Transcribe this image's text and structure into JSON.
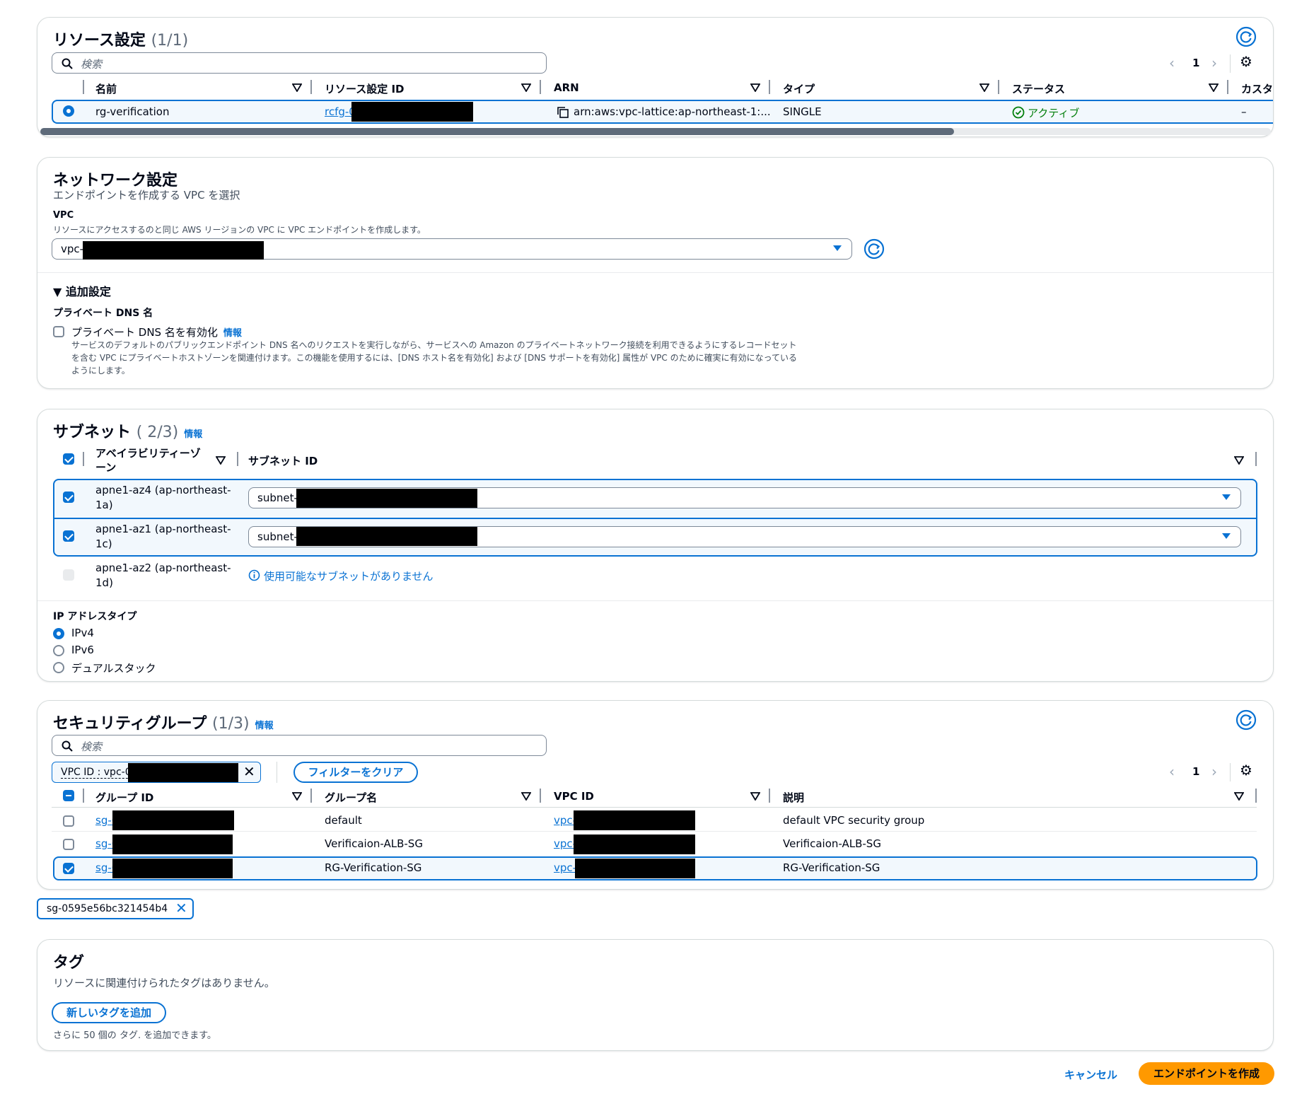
{
  "resource_config": {
    "title": "リソース設定",
    "count": "(1/1)",
    "search_placeholder": "検索",
    "page": "1",
    "columns": [
      "名前",
      "リソース設定 ID",
      "ARN",
      "タイプ",
      "ステータス",
      "カスタ"
    ],
    "row": {
      "name": "rg-verification",
      "id_prefix": "rcfg-0",
      "arn": "arn:aws:vpc-lattice:ap-northeast-1:...",
      "type": "SINGLE",
      "status": "アクティブ",
      "custom": "–"
    }
  },
  "network": {
    "title": "ネットワーク設定",
    "subtitle": "エンドポイントを作成する VPC を選択",
    "vpc_label": "VPC",
    "vpc_desc": "リソースにアクセスするのと同じ AWS リージョンの VPC に VPC エンドポイントを作成します。",
    "vpc_value_prefix": "vpc-",
    "additional": "追加設定",
    "private_dns_heading": "プライベート DNS 名",
    "private_dns_checkbox": "プライベート DNS 名を有効化",
    "info": "情報",
    "private_dns_desc1": "サービスのデフォルトのパブリックエンドポイント DNS 名へのリクエストを実行しながら、サービスへの Amazon のプライベートネットワーク接続を利用できるようにするレコードセット",
    "private_dns_desc2": "を含む VPC にプライベートホストゾーンを関連付けます。この機能を使用するには、[DNS ホスト名を有効化] および [DNS サポートを有効化] 属性が VPC のために確実に有効になっている",
    "private_dns_desc3": "ようにします。"
  },
  "subnets": {
    "title": "サブネット",
    "count": "( 2/3)",
    "info": "情報",
    "col_az_1": "アベイラビリティーゾ",
    "col_az_2": "ーン",
    "col_subnet": "サブネット ID",
    "rows": [
      {
        "az1": "apne1-az4 (ap-northeast-",
        "az2": "1a)",
        "subnet_prefix": "subnet-"
      },
      {
        "az1": "apne1-az1 (ap-northeast-",
        "az2": "1c)",
        "subnet_prefix": "subnet-"
      },
      {
        "az1": "apne1-az2 (ap-northeast-",
        "az2": "1d)",
        "none": "使用可能なサブネットがありません"
      }
    ],
    "ip_type_label": "IP アドレスタイプ",
    "ip_options": [
      "IPv4",
      "IPv6",
      "デュアルスタック"
    ]
  },
  "security_groups": {
    "title": "セキュリティグループ",
    "count": "(1/3)",
    "info": "情報",
    "search_placeholder": "検索",
    "filter_token": "VPC ID : vpc-0",
    "clear_filter": "フィルターをクリア",
    "page": "1",
    "columns": [
      "グループ ID",
      "グループ名",
      "VPC ID",
      "説明"
    ],
    "rows": [
      {
        "id_prefix": "sg-0",
        "name": "default",
        "vpc_prefix": "vpc-",
        "desc": "default VPC security group"
      },
      {
        "id_prefix": "sg-0",
        "name": "Verificaion-ALB-SG",
        "vpc_prefix": "vpc-",
        "desc": "Verificaion-ALB-SG"
      },
      {
        "id_prefix": "sg-0",
        "name": "RG-Verification-SG",
        "vpc_prefix": "vpc-",
        "desc": "RG-Verification-SG"
      }
    ],
    "selected_token": "sg-0595e56bc321454b4"
  },
  "tags": {
    "title": "タグ",
    "empty": "リソースに関連付けられたタグはありません。",
    "add_button": "新しいタグを追加",
    "hint": "さらに 50 個の タグ. を追加できます。"
  },
  "footer": {
    "cancel": "キャンセル",
    "create": "エンドポイントを作成"
  },
  "colors": {
    "accent": "#0972d3",
    "primary": "#ff9900",
    "success": "#037f0c"
  }
}
